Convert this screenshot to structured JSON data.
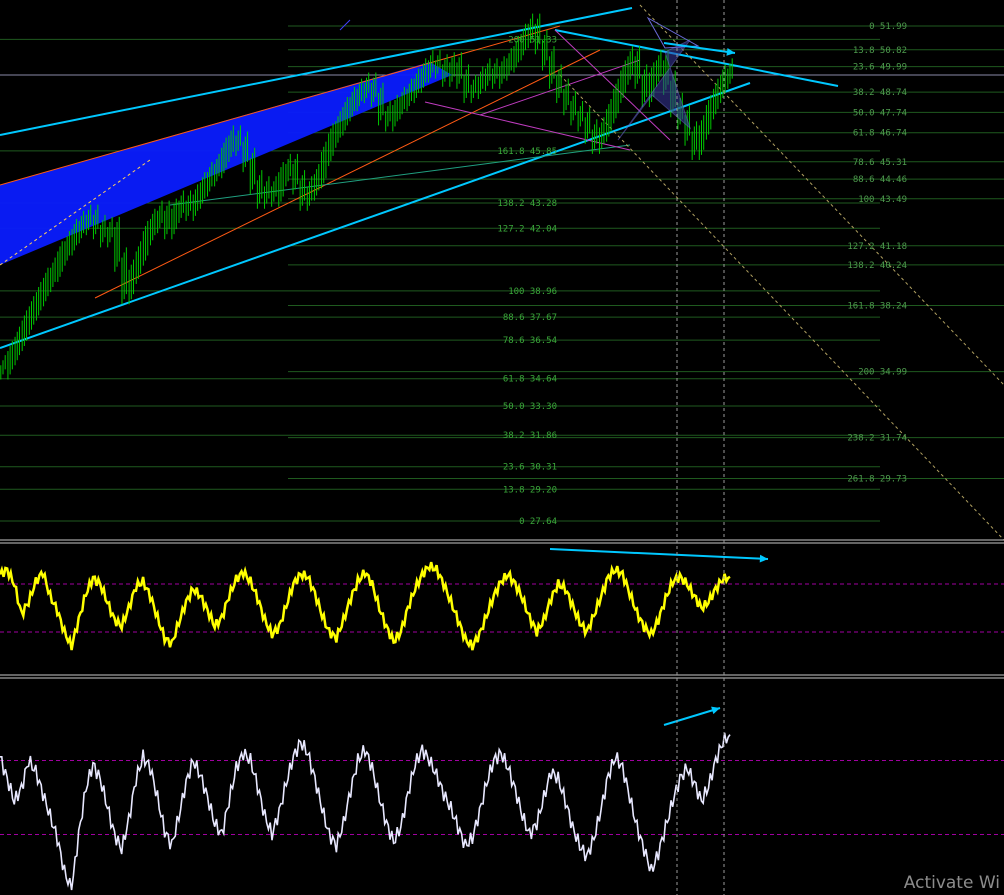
{
  "watermark": "Activate Wi",
  "colors": {
    "background": "#000000",
    "candles": "#00c800",
    "channel": "#00c8ff",
    "blue_band": "#0a1cff",
    "fib_grid": "#1f5a1f",
    "fib_text": "#3aa63a",
    "orange_line": "#ff5a14",
    "magenta_line": "#c03cc0",
    "dotted_diag": "#b0a060",
    "yellow_osc": "#ffff00",
    "white_osc": "#e8e8ff",
    "pane_border": "#c8c8c8",
    "level_dash": "#a000a0"
  },
  "chart_data": [
    {
      "type": "line",
      "name": "price",
      "series_kind": "candles",
      "fib_levels_left": [
        {
          "label": "200 51.33",
          "value": 51.33
        },
        {
          "label": "161.8 45.85",
          "value": 45.85
        },
        {
          "label": "138.2 43.28",
          "value": 43.28
        },
        {
          "label": "127.2 42.04",
          "value": 42.04
        },
        {
          "label": "100 38.96",
          "value": 38.96
        },
        {
          "label": "88.6 37.67",
          "value": 37.67
        },
        {
          "label": "78.6 36.54",
          "value": 36.54
        },
        {
          "label": "61.8 34.64",
          "value": 34.64
        },
        {
          "label": "50.0 33.30",
          "value": 33.3
        },
        {
          "label": "38.2 31.86",
          "value": 31.86
        },
        {
          "label": "23.6 30.31",
          "value": 30.31
        },
        {
          "label": "13.8 29.20",
          "value": 29.2
        },
        {
          "label": "0 27.64",
          "value": 27.64
        }
      ],
      "fib_levels_right": [
        {
          "label": "0 51.99",
          "value": 51.99
        },
        {
          "label": "13.8 50.82",
          "value": 50.82
        },
        {
          "label": "23.6 49.99",
          "value": 49.99
        },
        {
          "label": "38.2 48.74",
          "value": 48.74
        },
        {
          "label": "50.0 47.74",
          "value": 47.74
        },
        {
          "label": "61.8 46.74",
          "value": 46.74
        },
        {
          "label": "78.6 45.31",
          "value": 45.31
        },
        {
          "label": "88.6 44.46",
          "value": 44.46
        },
        {
          "label": "100 43.49",
          "value": 43.49
        },
        {
          "label": "127.2 41.18",
          "value": 41.18
        },
        {
          "label": "138.2 40.24",
          "value": 40.24
        },
        {
          "label": "161.8 38.24",
          "value": 38.24
        },
        {
          "label": "200 34.99",
          "value": 34.99
        },
        {
          "label": "238.2 31.74",
          "value": 31.74
        },
        {
          "label": "261.8 29.73",
          "value": 29.73
        }
      ],
      "ylim": [
        26.5,
        53.5
      ],
      "close": [
        35.2,
        35.9,
        36.6,
        37.4,
        38.1,
        38.8,
        39.5,
        40.0,
        40.8,
        41.3,
        41.9,
        42.3,
        42.6,
        42.1,
        41.7,
        42.0,
        40.5,
        38.9,
        39.9,
        40.8,
        41.8,
        42.4,
        42.8,
        42.1,
        42.9,
        43.3,
        43.0,
        43.6,
        44.2,
        44.7,
        45.1,
        45.9,
        46.5,
        46.2,
        45.4,
        44.3,
        43.6,
        44.0,
        43.7,
        44.7,
        45.1,
        44.3,
        43.5,
        44.0,
        44.6,
        45.7,
        46.6,
        47.2,
        47.9,
        48.4,
        48.8,
        49.1,
        48.6,
        47.7,
        47.4,
        48.0,
        48.4,
        48.8,
        49.3,
        49.8,
        50.2,
        50.0,
        49.6,
        50.1,
        49.5,
        48.8,
        49.0,
        49.4,
        49.8,
        49.5,
        49.9,
        50.3,
        50.9,
        51.5,
        52.0,
        51.2,
        50.4,
        49.5,
        48.8,
        48.2,
        47.7,
        47.4,
        46.8,
        46.3,
        46.9,
        47.8,
        48.8,
        49.7,
        50.4,
        49.5,
        48.6,
        49.6,
        50.2,
        49.2,
        48.1,
        47.5,
        46.7,
        46.0,
        47.0,
        48.0,
        48.8,
        49.5,
        49.8
      ]
    },
    {
      "type": "line",
      "name": "oscillator-1",
      "ylim": [
        0,
        100
      ],
      "levels": [
        70,
        30
      ],
      "values": [
        78,
        82,
        70,
        45,
        55,
        72,
        80,
        60,
        48,
        30,
        18,
        40,
        62,
        75,
        70,
        55,
        40,
        35,
        50,
        68,
        72,
        60,
        42,
        25,
        20,
        38,
        55,
        66,
        60,
        48,
        35,
        42,
        60,
        74,
        80,
        72,
        58,
        40,
        28,
        34,
        52,
        70,
        78,
        76,
        62,
        44,
        30,
        25,
        40,
        58,
        72,
        80,
        70,
        50,
        34,
        22,
        30,
        50,
        66,
        78,
        85,
        82,
        70,
        55,
        40,
        24,
        18,
        28,
        44,
        60,
        72,
        78,
        70,
        58,
        42,
        30,
        40,
        58,
        70,
        66,
        52,
        38,
        30,
        44,
        60,
        76,
        82,
        78,
        62,
        46,
        34,
        28,
        40,
        58,
        72,
        76,
        70,
        60,
        50,
        55,
        66,
        74,
        76
      ]
    },
    {
      "type": "line",
      "name": "oscillator-2",
      "ylim": [
        0,
        100
      ],
      "levels": [
        70,
        30
      ],
      "values": [
        72,
        60,
        48,
        55,
        70,
        64,
        52,
        40,
        28,
        10,
        0,
        30,
        55,
        68,
        60,
        45,
        30,
        22,
        38,
        60,
        72,
        66,
        50,
        32,
        24,
        40,
        58,
        70,
        62,
        50,
        36,
        30,
        48,
        66,
        74,
        70,
        56,
        40,
        30,
        42,
        58,
        72,
        80,
        74,
        60,
        44,
        30,
        24,
        36,
        54,
        70,
        76,
        66,
        50,
        36,
        26,
        34,
        52,
        68,
        76,
        70,
        62,
        52,
        44,
        34,
        24,
        28,
        42,
        58,
        70,
        74,
        66,
        54,
        40,
        30,
        36,
        50,
        64,
        60,
        48,
        34,
        24,
        18,
        28,
        44,
        62,
        72,
        66,
        50,
        34,
        22,
        10,
        20,
        34,
        48,
        60,
        66,
        58,
        48,
        56,
        70,
        80,
        84
      ]
    }
  ]
}
